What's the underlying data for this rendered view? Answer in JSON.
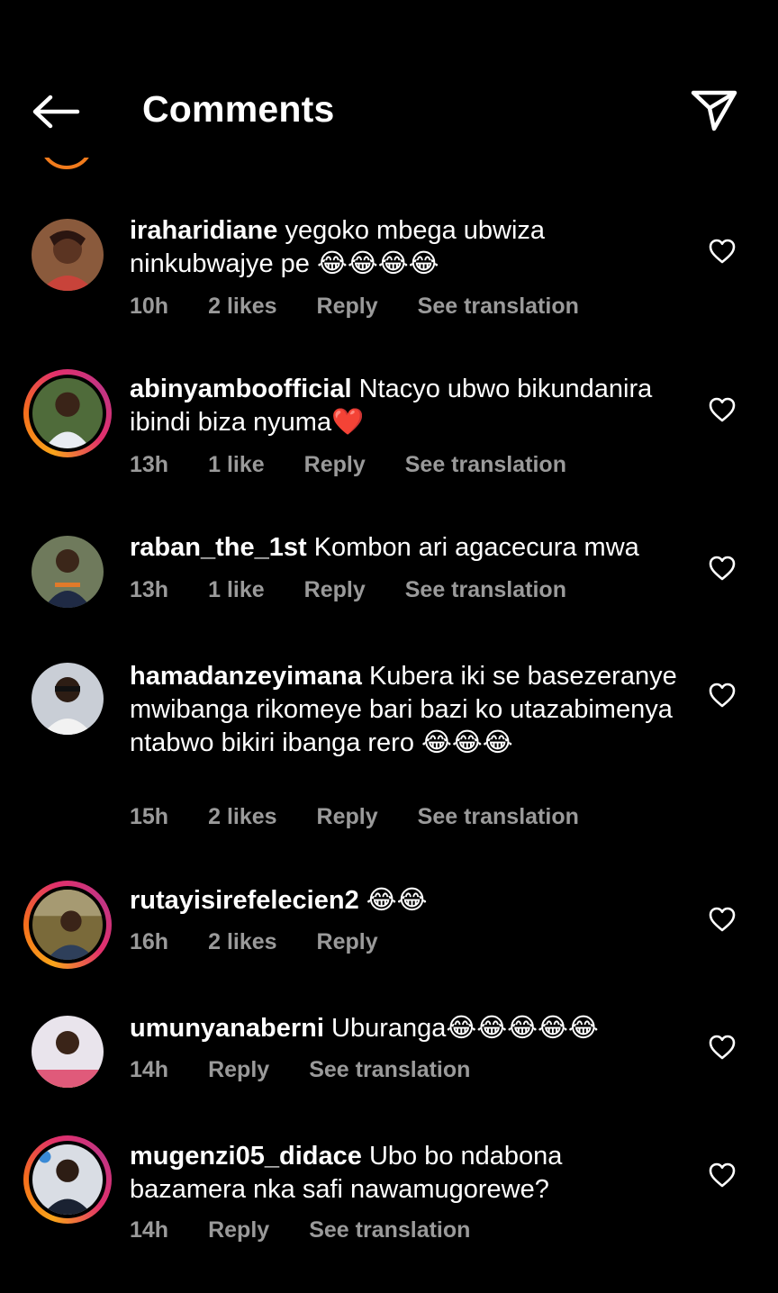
{
  "header": {
    "title": "Comments"
  },
  "actions": {
    "reply": "Reply",
    "see_translation": "See translation"
  },
  "comments": [
    {
      "username": "iraharidiane",
      "text": "yegoko mbega ubwiza ninkubwajye pe 😂😂😂😂",
      "time": "10h",
      "likes": "2 likes"
    },
    {
      "username": "abinyamboofficial",
      "text": "Ntacyo ubwo bikundanira ibindi biza nyuma❤️",
      "time": "13h",
      "likes": "1 like"
    },
    {
      "username": "raban_the_1st",
      "text": "Kombon ari agacecura mwa",
      "time": "13h",
      "likes": "1 like"
    },
    {
      "username": "hamadanzeyimana",
      "text": "Kubera iki se basezeranye mwibanga rikomeye bari bazi ko utazabimenya ntabwo bikiri ibanga rero 😂😂😂",
      "time": "15h",
      "likes": "2 likes"
    },
    {
      "username": "rutayisirefelecien2",
      "text": "😂😂",
      "time": "16h",
      "likes": "2 likes"
    },
    {
      "username": "umunyanaberni",
      "text": "Uburanga😂😂😂😂😂",
      "time": "14h",
      "likes": ""
    },
    {
      "username": "mugenzi05_didace",
      "text": "Ubo bo ndabona bazamera nka safi nawamugorewe?",
      "time": "14h",
      "likes": ""
    }
  ],
  "icons": {
    "back": "arrow-left-icon",
    "share": "paper-plane-icon",
    "like": "heart-outline-icon"
  },
  "colors": {
    "background": "#000000",
    "text": "#ffffff",
    "meta": "#9a9a9a",
    "ring_start": "#f9a41a",
    "ring_end": "#c13584"
  }
}
